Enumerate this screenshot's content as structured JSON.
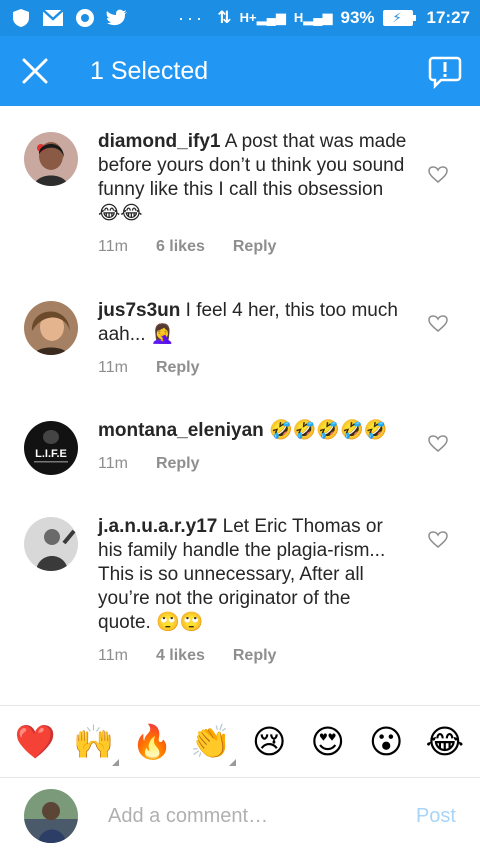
{
  "status_bar": {
    "battery_percent": "93%",
    "time": "17:27",
    "dots": "···",
    "signal_label_1": "H+",
    "signal_label_2": "H"
  },
  "app_bar": {
    "title": "1 Selected"
  },
  "comments": [
    {
      "username": "diamond_ify1",
      "text": " A post that was made before yours don’t u think you sound funny like this I call this obsession 😂😂",
      "time": "11m",
      "likes": "6 likes",
      "reply": "Reply"
    },
    {
      "username": "jus7s3un",
      "text": " I feel 4 her, this too much aah... 🤦‍♀️",
      "time": "11m",
      "reply": "Reply"
    },
    {
      "username": "montana_eleniyan",
      "text": " 🤣🤣🤣🤣🤣",
      "time": "11m",
      "reply": "Reply",
      "avatar_text": "L.I.F.E"
    },
    {
      "username": "j.a.n.u.a.r.y17",
      "text": " Let Eric Thomas or his family  handle the plagia-rism... This is so unnecessary, After all you’re not the originator of the quote. 🙄🙄",
      "time": "11m",
      "likes": "4 likes",
      "reply": "Reply"
    }
  ],
  "emoji_bar": [
    "❤️",
    "🙌",
    "🔥",
    "👏",
    "😢",
    "😍",
    "😮",
    "😂"
  ],
  "comment_input": {
    "placeholder": "Add a comment…",
    "post_label": "Post"
  },
  "colors": {
    "status_bar": "#1c8ee3",
    "app_bar": "#2196f3",
    "post_disabled": "#a8d4f7"
  }
}
